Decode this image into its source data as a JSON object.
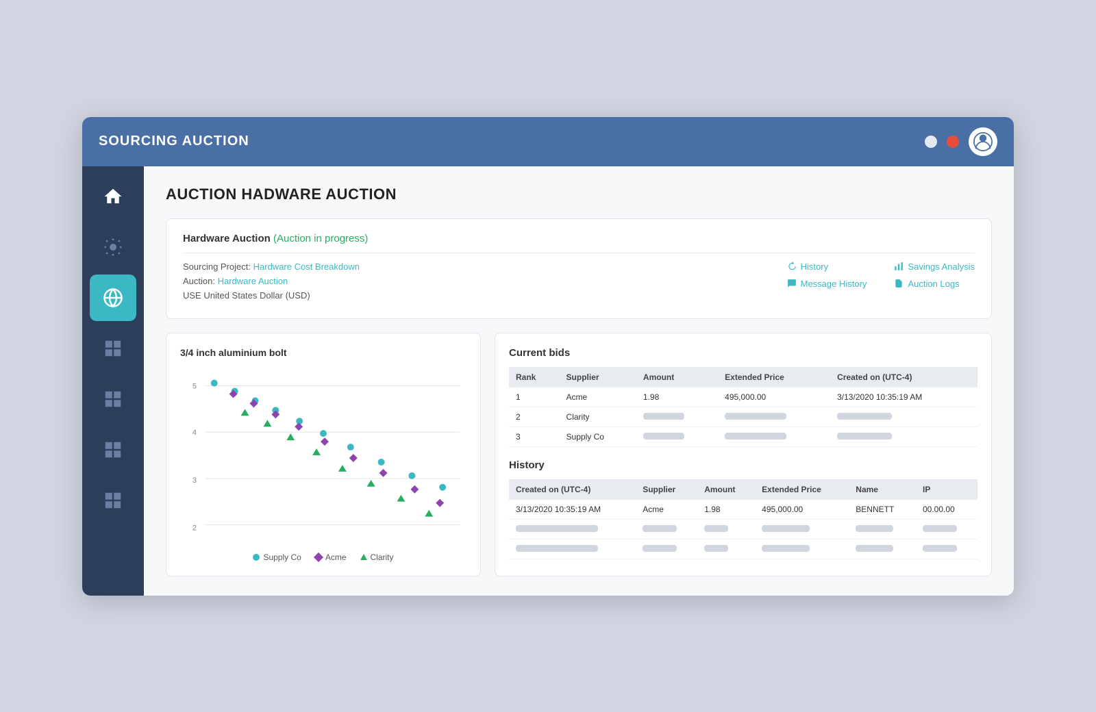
{
  "topbar": {
    "title": "SOURCING AUCTION"
  },
  "page": {
    "title": "AUCTION HADWARE AUCTION"
  },
  "auction_card": {
    "header": "Hardware Auction",
    "status": "(Auction in progress)",
    "sourcing_label": "Sourcing Project:",
    "sourcing_link": "Hardware Cost Breakdown",
    "auction_label": "Auction:",
    "auction_link": "Hardware Auction",
    "currency": "USE United States Dollar (USD)",
    "links": {
      "history": "History",
      "message_history": "Message History",
      "savings_analysis": "Savings Analysis",
      "auction_logs": "Auction Logs"
    }
  },
  "chart": {
    "title": "3/4 inch aluminium bolt",
    "y_labels": [
      "5",
      "4",
      "3",
      "2"
    ],
    "legend": {
      "supply_co": "Supply Co",
      "acme": "Acme",
      "clarity": "Clarity"
    }
  },
  "current_bids": {
    "section_title": "Current bids",
    "columns": [
      "Rank",
      "Supplier",
      "Amount",
      "Extended Price",
      "Created on (UTC-4)"
    ],
    "rows": [
      {
        "rank": "1",
        "supplier": "Acme",
        "amount": "1.98",
        "extended_price": "495,000.00",
        "created_on": "3/13/2020  10:35:19 AM"
      },
      {
        "rank": "2",
        "supplier": "Clarity",
        "amount": "",
        "extended_price": "",
        "created_on": ""
      },
      {
        "rank": "3",
        "supplier": "Supply Co",
        "amount": "",
        "extended_price": "",
        "created_on": ""
      }
    ]
  },
  "history": {
    "section_title": "History",
    "columns": [
      "Created on (UTC-4)",
      "Supplier",
      "Amount",
      "Extended Price",
      "Name",
      "IP"
    ],
    "rows": [
      {
        "created_on": "3/13/2020  10:35:19 AM",
        "supplier": "Acme",
        "amount": "1.98",
        "extended_price": "495,000.00",
        "name": "BENNETT",
        "ip": "00.00.00"
      },
      {
        "created_on": "",
        "supplier": "",
        "amount": "",
        "extended_price": "",
        "name": "",
        "ip": ""
      },
      {
        "created_on": "",
        "supplier": "",
        "amount": "",
        "extended_price": "",
        "name": "",
        "ip": ""
      }
    ]
  }
}
